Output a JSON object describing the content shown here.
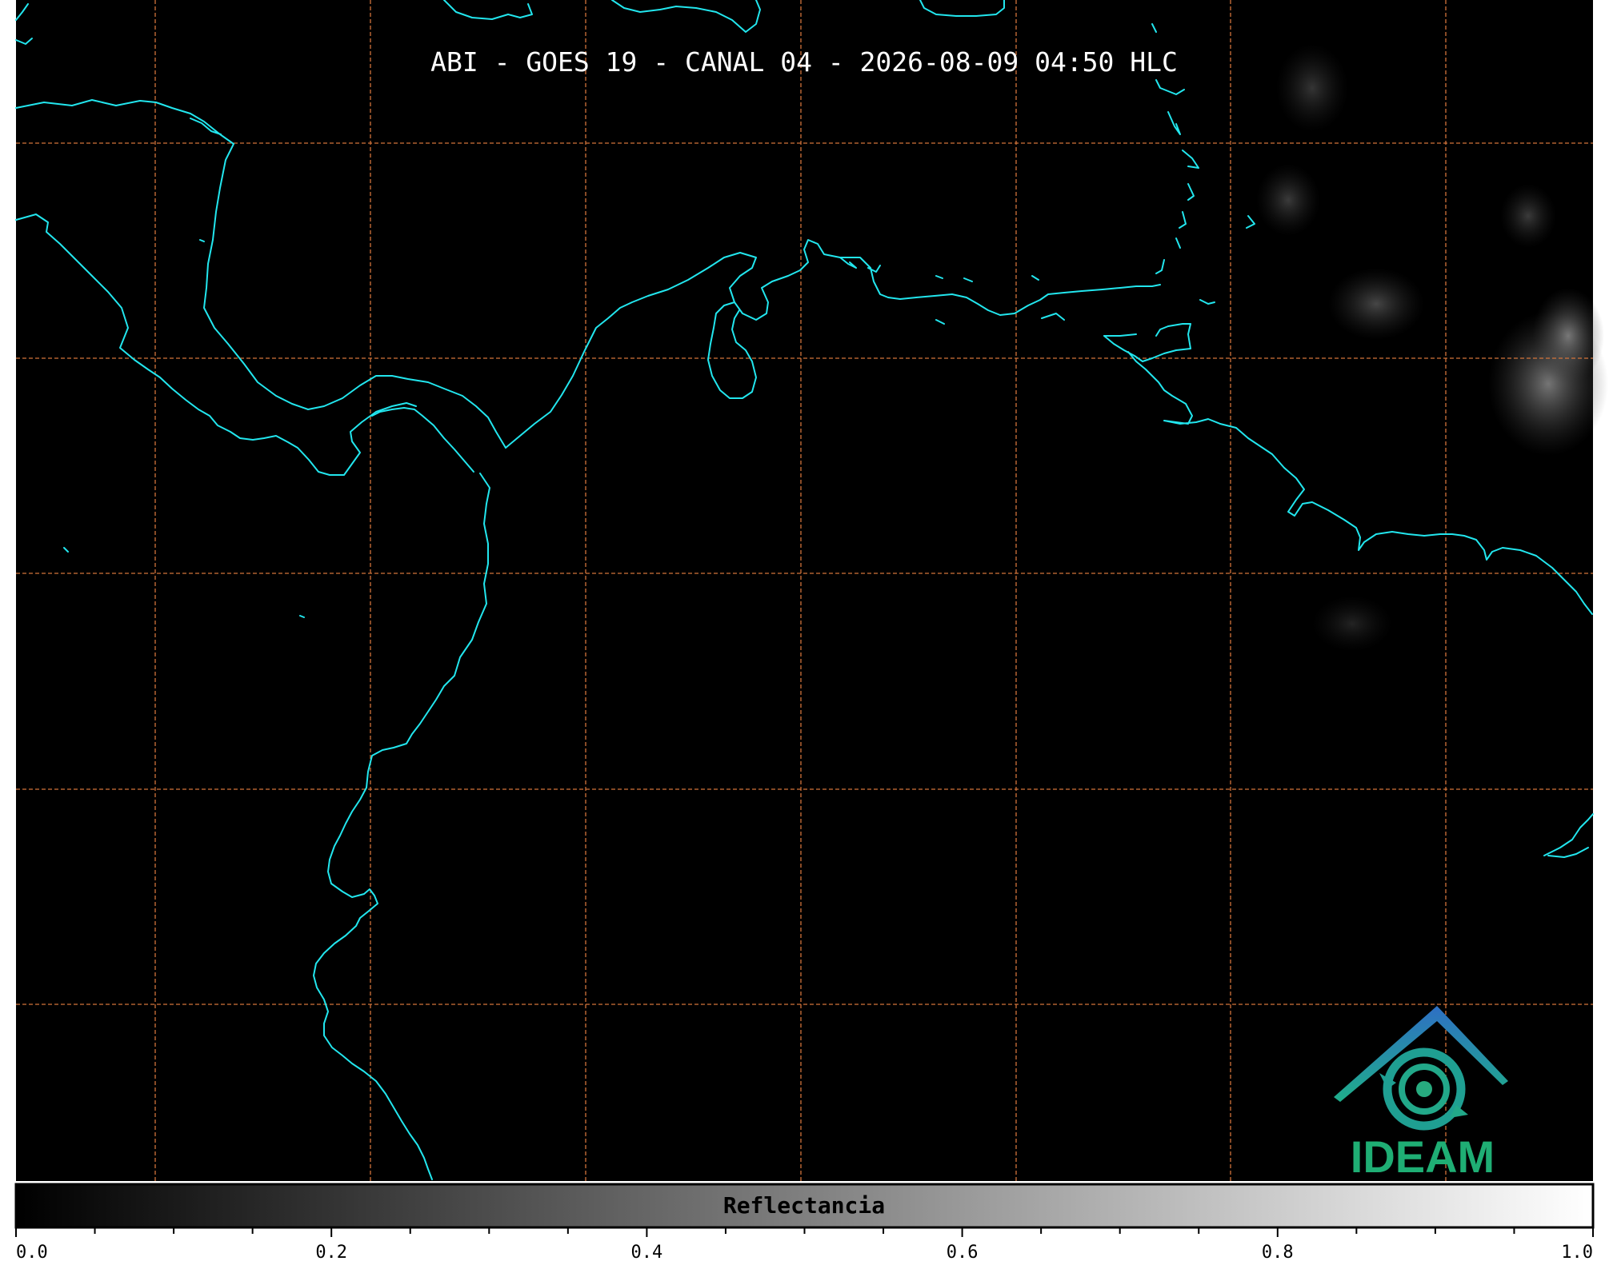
{
  "title": "ABI - GOES 19 - CANAL 04 - 2026-08-09 04:50 HLC",
  "logo": {
    "text": "IDEAM",
    "color": "#1fae74"
  },
  "colorbar": {
    "label": "Reflectancia",
    "min": 0.0,
    "max": 1.0,
    "ticks": [
      "0.0",
      "0.2",
      "0.4",
      "0.6",
      "0.8",
      "1.0"
    ],
    "colormap": "grayscale"
  },
  "colors": {
    "background": "#000000",
    "coastline": "#22e6ee",
    "gridline": "#d2733a"
  }
}
